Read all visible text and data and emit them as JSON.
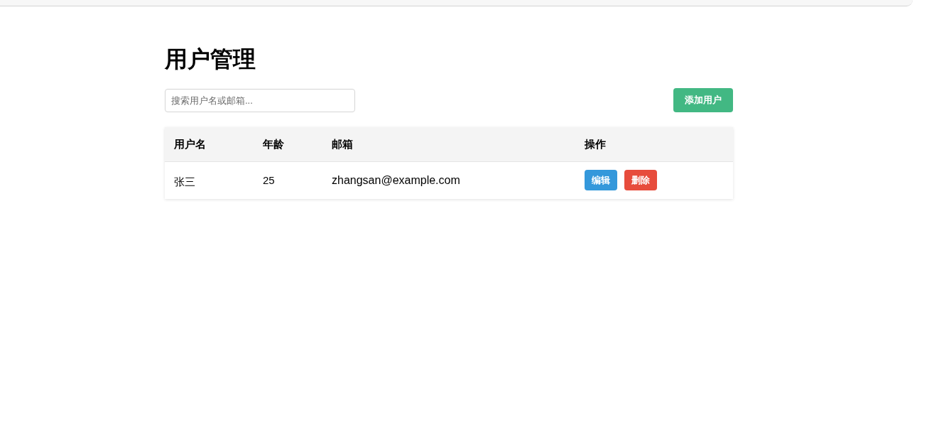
{
  "title": "用户管理",
  "search": {
    "placeholder": "搜索用户名或邮箱..."
  },
  "add_button": "添加用户",
  "table": {
    "columns": [
      "用户名",
      "年龄",
      "邮箱",
      "操作"
    ],
    "rows": [
      {
        "username": "张三",
        "age": "25",
        "email": "zhangsan@example.com",
        "actions": [
          {
            "kind": "edit",
            "label": "编辑"
          },
          {
            "kind": "delete",
            "label": "删除"
          }
        ]
      }
    ]
  }
}
